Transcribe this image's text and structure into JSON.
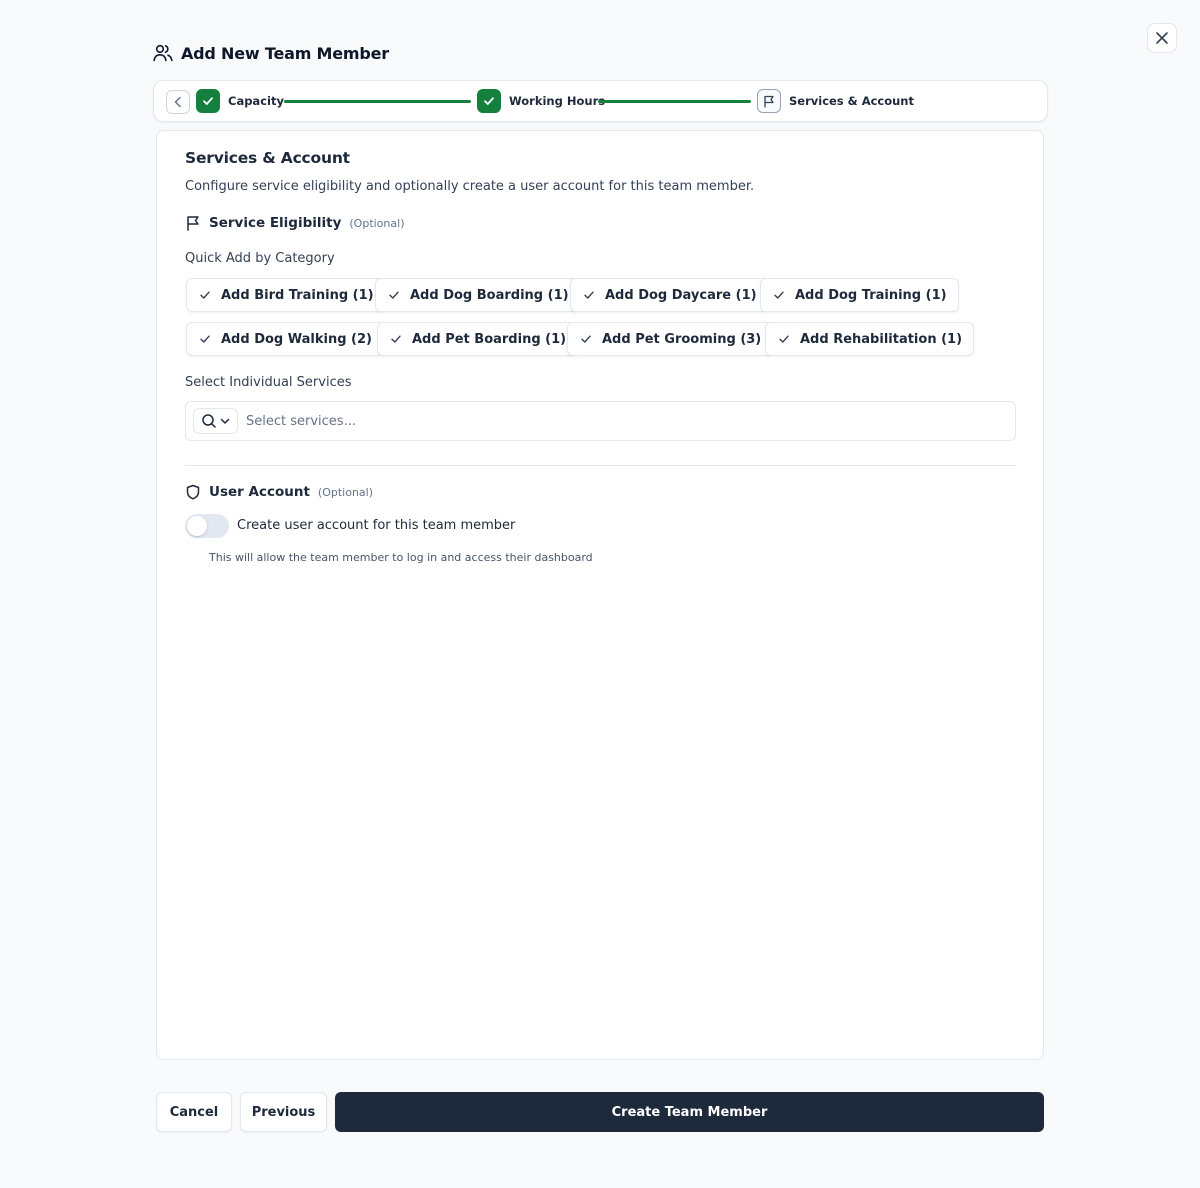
{
  "dialog": {
    "title": "Add New Team Member",
    "close_icon": "x-icon"
  },
  "stepper": {
    "steps": [
      {
        "label": "Capacity",
        "state": "completed"
      },
      {
        "label": "Working Hours",
        "state": "completed"
      },
      {
        "label": "Services & Account",
        "state": "current"
      }
    ],
    "accent_color": "#15803d"
  },
  "main": {
    "title": "Services & Account",
    "description": "Configure service eligibility and optionally create a user account for this team member.",
    "service_eligibility": {
      "title": "Service Eligibility",
      "optional_label": "(Optional)",
      "quick_add_label": "Quick Add by Category",
      "quick_add_buttons": [
        "Add Bird Training (1)",
        "Add Dog Boarding (1)",
        "Add Dog Daycare (1)",
        "Add Dog Training (1)",
        "Add Dog Walking (2)",
        "Add Pet Boarding (1)",
        "Add Pet Grooming (3)",
        "Add Rehabilitation (1)"
      ],
      "individual_label": "Select Individual Services",
      "select_placeholder": "Select services..."
    },
    "user_account": {
      "title": "User Account",
      "optional_label": "(Optional)",
      "toggle_label": "Create user account for this team member",
      "toggle_on": false,
      "help_text": "This will allow the team member to log in and access their dashboard"
    }
  },
  "footer": {
    "cancel": "Cancel",
    "previous": "Previous",
    "create": "Create Team Member"
  },
  "colors": {
    "primary_button": "#1e293b",
    "success": "#15803d",
    "background": "#f8fafc"
  }
}
